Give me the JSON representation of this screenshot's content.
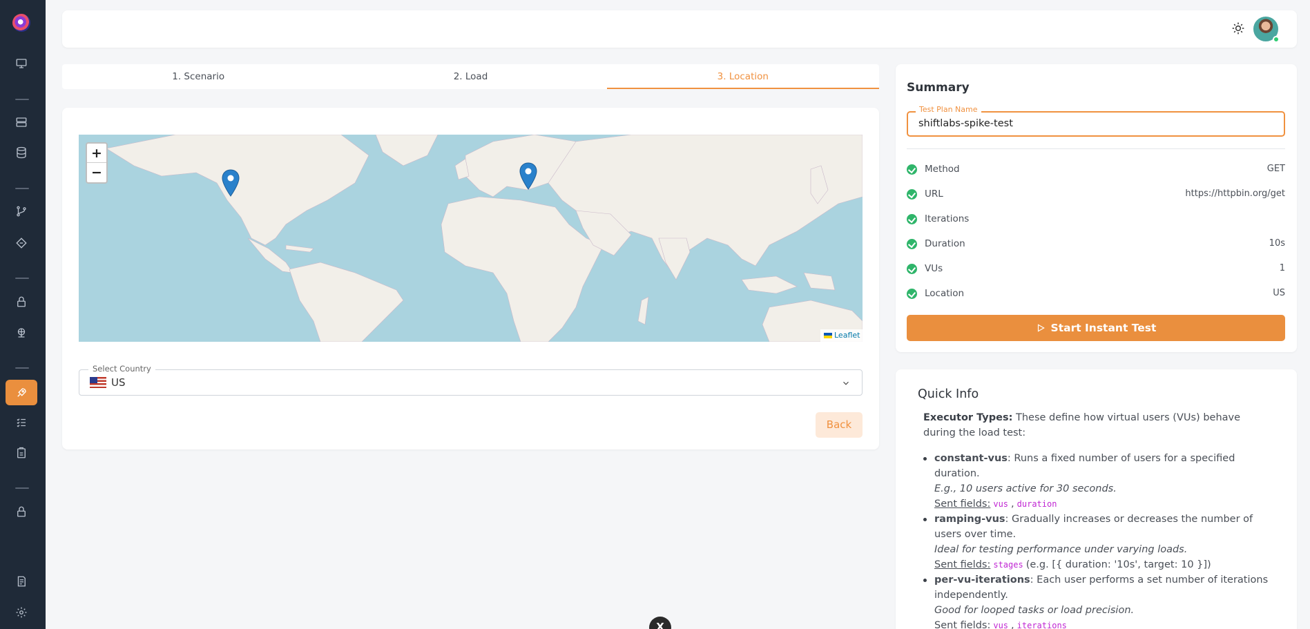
{
  "stepper": {
    "steps": [
      "1. Scenario",
      "2. Load",
      "3. Location"
    ],
    "active_index": 2
  },
  "map": {
    "zoom_in": "+",
    "zoom_out": "−",
    "attribution": "Leaflet"
  },
  "country_select": {
    "label": "Select Country",
    "value": "US"
  },
  "back_label": "Back",
  "summary": {
    "title": "Summary",
    "plan_name_label": "Test Plan Name",
    "plan_name_value": "shiftlabs-spike-test",
    "rows": [
      {
        "label": "Method",
        "value": "GET"
      },
      {
        "label": "URL",
        "value": "https://httpbin.org/get"
      },
      {
        "label": "Iterations",
        "value": ""
      },
      {
        "label": "Duration",
        "value": "10s"
      },
      {
        "label": "VUs",
        "value": "1"
      },
      {
        "label": "Location",
        "value": "US"
      }
    ],
    "start_label": "Start Instant Test"
  },
  "quick_info": {
    "title": "Quick Info",
    "intro_bold": "Executor Types:",
    "intro_text": " These define how virtual users (VUs) behave during the load test:",
    "sent_fields_label": "Sent fields:",
    "items": [
      {
        "name": "constant-vus",
        "desc": ": Runs a fixed number of users for a specified duration.",
        "example": "E.g., 10 users active for 30 seconds.",
        "fields": [
          "vus",
          ",",
          "duration"
        ],
        "extra": ""
      },
      {
        "name": "ramping-vus",
        "desc": ": Gradually increases or decreases the number of users over time.",
        "example": "Ideal for testing performance under varying loads.",
        "fields": [
          "stages"
        ],
        "extra": "(e.g. [{ duration: '10s', target: 10 }])"
      },
      {
        "name": "per-vu-iterations",
        "desc": ": Each user performs a set number of iterations independently.",
        "example": "Good for looped tasks or load precision.",
        "fields": [
          "vus",
          ",",
          "iterations"
        ],
        "extra": ""
      }
    ]
  },
  "float_badge": "X",
  "colors": {
    "accent": "#ea8f3e",
    "sidebar": "#1f2a38",
    "success": "#2fb56a",
    "map_water": "#aad3df",
    "map_land": "#f2efe9",
    "marker": "#2a81cb"
  }
}
